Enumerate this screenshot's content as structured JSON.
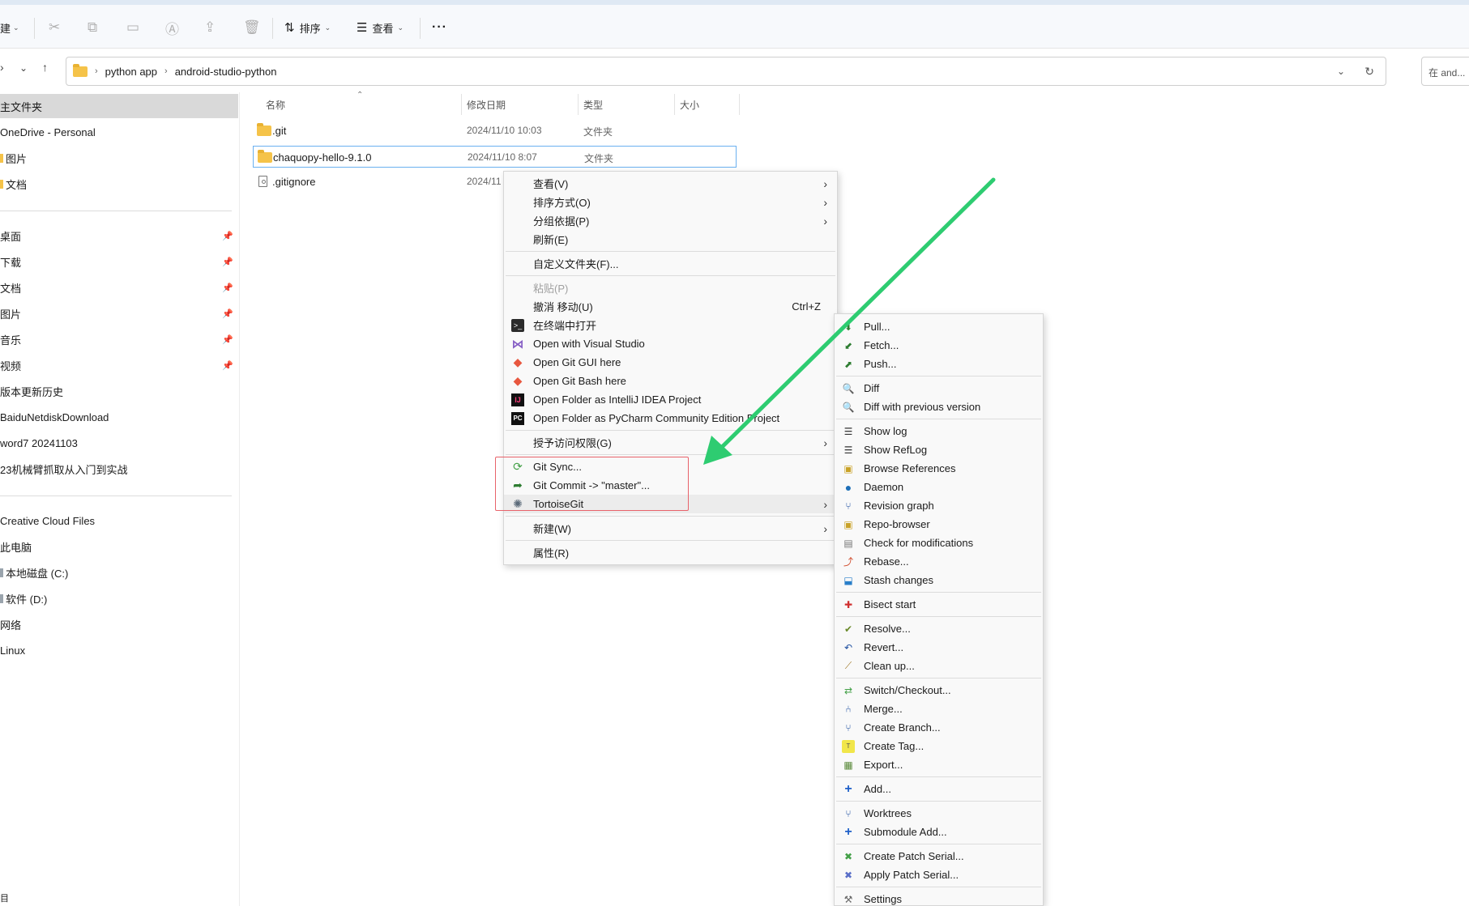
{
  "toolbar": {
    "new_label": "建",
    "sort_label": "排序",
    "view_label": "查看",
    "more_label": "···"
  },
  "address": {
    "crumbs": [
      "python app",
      "android-studio-python"
    ],
    "search_placeholder": "在 and..."
  },
  "sidebar": {
    "home": "主文件夹",
    "onedrive": "OneDrive - Personal",
    "od_pictures": "图片",
    "od_docs": "文档",
    "quick": [
      "桌面",
      "下载",
      "文档",
      "图片",
      "音乐",
      "视频",
      "版本更新历史",
      "BaiduNetdiskDownload",
      "word7 20241103",
      "23机械臂抓取从入门到实战"
    ],
    "creative": "Creative Cloud Files",
    "thispc": "此电脑",
    "drive_c": "本地磁盘 (C:)",
    "drive_d": "软件 (D:)",
    "network": "网络",
    "linux": "Linux",
    "bottom_char": "目"
  },
  "columns": {
    "name": "名称",
    "date": "修改日期",
    "type": "类型",
    "size": "大小"
  },
  "files": [
    {
      "name": ".git",
      "date": "2024/11/10 10:03",
      "type": "文件夹"
    },
    {
      "name": "chaquopy-hello-9.1.0",
      "date": "2024/11/10 8:07",
      "type": "文件夹"
    },
    {
      "name": ".gitignore",
      "date": "2024/11",
      "type": ""
    }
  ],
  "context_menu": {
    "view": "查看(V)",
    "sort": "排序方式(O)",
    "group": "分组依据(P)",
    "refresh": "刷新(E)",
    "customize": "自定义文件夹(F)...",
    "paste": "粘贴(P)",
    "undo": "撤消 移动(U)",
    "undo_shortcut": "Ctrl+Z",
    "terminal": "在终端中打开",
    "vs": "Open with Visual Studio",
    "git_gui": "Open Git GUI here",
    "git_bash": "Open Git Bash here",
    "intellij": "Open Folder as IntelliJ IDEA Project",
    "pycharm": "Open Folder as PyCharm Community Edition Project",
    "access": "授予访问权限(G)",
    "git_sync": "Git Sync...",
    "git_commit": "Git Commit -> \"master\"...",
    "tortoise": "TortoiseGit",
    "new": "新建(W)",
    "properties": "属性(R)"
  },
  "tortoise_menu": {
    "pull": "Pull...",
    "fetch": "Fetch...",
    "push": "Push...",
    "diff": "Diff",
    "diff_prev": "Diff with previous version",
    "show_log": "Show log",
    "show_reflog": "Show RefLog",
    "browse_refs": "Browse References",
    "daemon": "Daemon",
    "revision_graph": "Revision graph",
    "repo_browser": "Repo-browser",
    "check_mods": "Check for modifications",
    "rebase": "Rebase...",
    "stash": "Stash changes",
    "bisect": "Bisect start",
    "resolve": "Resolve...",
    "revert": "Revert...",
    "cleanup": "Clean up...",
    "switch": "Switch/Checkout...",
    "merge": "Merge...",
    "branch": "Create Branch...",
    "tag": "Create Tag...",
    "export": "Export...",
    "add": "Add...",
    "worktrees": "Worktrees",
    "submodule_add": "Submodule Add...",
    "patch_serial": "Create Patch Serial...",
    "apply_patch": "Apply Patch Serial...",
    "settings": "Settings"
  },
  "colors": {
    "arrow": "#2ecc71",
    "highlight_box": "#e8636b",
    "selection_border": "#6ab0f0"
  }
}
